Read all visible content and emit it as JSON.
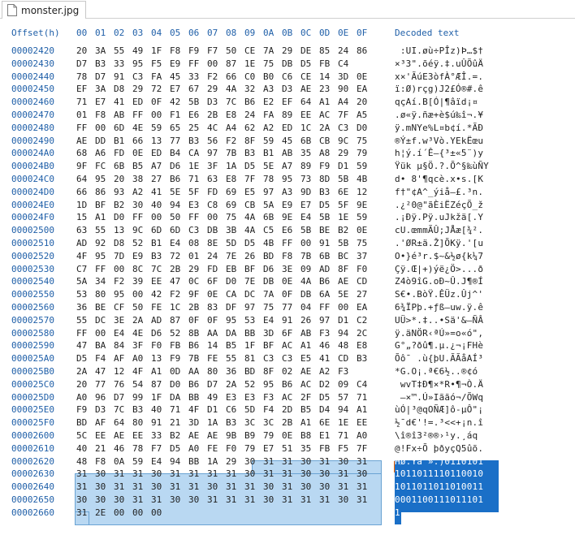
{
  "tab": {
    "title": "monster.jpg"
  },
  "header": {
    "offset_label": "Offset(h)",
    "columns": [
      "00",
      "01",
      "02",
      "03",
      "04",
      "05",
      "06",
      "07",
      "08",
      "09",
      "0A",
      "0B",
      "0C",
      "0D",
      "0E",
      "0F"
    ],
    "decoded_label": "Decoded text"
  },
  "rows": [
    {
      "offset": "00002420",
      "hex": [
        "20",
        "3A",
        "55",
        "49",
        "1F",
        "F8",
        "F9",
        "F7",
        "50",
        "CE",
        "7A",
        "29",
        "DE",
        "85",
        "24",
        "86"
      ],
      "text": " :UI.øù÷PÎz)Þ…$†"
    },
    {
      "offset": "00002430",
      "hex": [
        "D7",
        "B3",
        "33",
        "95",
        "F5",
        "E9",
        "FF",
        "00",
        "87",
        "1E",
        "75",
        "DB",
        "D5",
        "FB",
        "C4"
      ],
      "text": "×³3\".õéÿ.‡.uÛÕûÄ"
    },
    {
      "offset": "00002440",
      "hex": [
        "78",
        "D7",
        "91",
        "C3",
        "FA",
        "45",
        "33",
        "F2",
        "66",
        "C0",
        "B0",
        "C6",
        "CE",
        "14",
        "3D",
        "0E"
      ],
      "text": "x×'ÃúE3òfÀ°ÆÎ.=."
    },
    {
      "offset": "00002450",
      "hex": [
        "EF",
        "3A",
        "D8",
        "29",
        "72",
        "E7",
        "67",
        "29",
        "4A",
        "32",
        "A3",
        "D3",
        "AE",
        "23",
        "90",
        "EA"
      ],
      "text": "ï:Ø)rçg)J2£Ó®#.ê"
    },
    {
      "offset": "00002460",
      "hex": [
        "71",
        "E7",
        "41",
        "ED",
        "0F",
        "42",
        "5B",
        "D3",
        "7C",
        "B6",
        "E2",
        "EF",
        "64",
        "A1",
        "A4",
        "20"
      ],
      "text": "qçAí.B[Ó|¶âïd¡¤ "
    },
    {
      "offset": "00002470",
      "hex": [
        "01",
        "F8",
        "AB",
        "FF",
        "00",
        "F1",
        "E6",
        "2B",
        "E8",
        "24",
        "FA",
        "89",
        "EE",
        "AC",
        "7F",
        "A5"
      ],
      "text": ".ø«ÿ.ñæ+è$ú‰î¬.¥"
    },
    {
      "offset": "00002480",
      "hex": [
        "FF",
        "00",
        "6D",
        "4E",
        "59",
        "65",
        "25",
        "4C",
        "A4",
        "62",
        "A2",
        "ED",
        "1C",
        "2A",
        "C3",
        "D0"
      ],
      "text": "ÿ.mNYe%L¤b¢í.*ÃÐ"
    },
    {
      "offset": "00002490",
      "hex": [
        "AE",
        "DD",
        "B1",
        "66",
        "13",
        "77",
        "B3",
        "56",
        "F2",
        "8F",
        "59",
        "45",
        "6B",
        "CB",
        "9C",
        "75"
      ],
      "text": "®Ý±f.w³Vò.YEkËœu"
    },
    {
      "offset": "000024A0",
      "hex": [
        "68",
        "A6",
        "FD",
        "0E",
        "ED",
        "B4",
        "CA",
        "97",
        "7B",
        "B3",
        "B1",
        "AB",
        "35",
        "A8",
        "29",
        "79"
      ],
      "text": "h¦ý.í´Ê—{³±«5¨)y"
    },
    {
      "offset": "000024B0",
      "hex": [
        "9F",
        "FC",
        "6B",
        "B5",
        "A7",
        "D6",
        "1E",
        "3F",
        "1A",
        "D5",
        "5E",
        "A7",
        "89",
        "F9",
        "D1",
        "59"
      ],
      "text": "Ÿük µ§Ö.?.Õ^§‰ùÑY"
    },
    {
      "offset": "000024C0",
      "hex": [
        "64",
        "95",
        "20",
        "38",
        "27",
        "B6",
        "71",
        "63",
        "E8",
        "7F",
        "78",
        "95",
        "73",
        "8D",
        "5B",
        "4B"
      ],
      "text": "d• 8'¶qcè.x•s.[K"
    },
    {
      "offset": "000024D0",
      "hex": [
        "66",
        "86",
        "93",
        "A2",
        "41",
        "5E",
        "5F",
        "FD",
        "69",
        "E5",
        "97",
        "A3",
        "9D",
        "B3",
        "6E",
        "12"
      ],
      "text": "f†\"¢A^_ýiå—£.³n."
    },
    {
      "offset": "000024E0",
      "hex": [
        "1D",
        "BF",
        "B2",
        "30",
        "40",
        "94",
        "E3",
        "C8",
        "69",
        "CB",
        "5A",
        "E9",
        "E7",
        "D5",
        "5F",
        "9E"
      ],
      "text": ".¿²0@\"ãÈiËZéçÕ_ž"
    },
    {
      "offset": "000024F0",
      "hex": [
        "15",
        "A1",
        "D0",
        "FF",
        "00",
        "50",
        "FF",
        "00",
        "75",
        "4A",
        "6B",
        "9E",
        "E4",
        "5B",
        "1E",
        "59"
      ],
      "text": ".¡Ðÿ.Pÿ.uJkžä[.Y"
    },
    {
      "offset": "00002500",
      "hex": [
        "63",
        "55",
        "13",
        "9C",
        "6D",
        "6D",
        "C3",
        "DB",
        "3B",
        "4A",
        "C5",
        "E6",
        "5B",
        "BE",
        "B2",
        "0E"
      ],
      "text": "cU.œmmÃÛ;JÅæ[¾²."
    },
    {
      "offset": "00002510",
      "hex": [
        "AD",
        "92",
        "D8",
        "52",
        "B1",
        "E4",
        "08",
        "8E",
        "5D",
        "D5",
        "4B",
        "FF",
        "00",
        "91",
        "5B",
        "75"
      ],
      "text": ".'ØR±ä.Ž]ÕKÿ.'[u"
    },
    {
      "offset": "00002520",
      "hex": [
        "4F",
        "95",
        "7D",
        "E9",
        "B3",
        "72",
        "01",
        "24",
        "7E",
        "26",
        "BD",
        "F8",
        "7B",
        "6B",
        "BC",
        "37"
      ],
      "text": "O•}é³r.$~&½ø{k¼7"
    },
    {
      "offset": "00002530",
      "hex": [
        "C7",
        "FF",
        "00",
        "8C",
        "7C",
        "2B",
        "29",
        "FD",
        "EB",
        "BF",
        "D6",
        "3E",
        "09",
        "AD",
        "8F",
        "F0"
      ],
      "text": "Çÿ.Œ|+)ýë¿Ö>...ð"
    },
    {
      "offset": "00002540",
      "hex": [
        "5A",
        "34",
        "F2",
        "39",
        "EE",
        "47",
        "0C",
        "6F",
        "D0",
        "7E",
        "DB",
        "0E",
        "4A",
        "B6",
        "AE",
        "CD"
      ],
      "text": "Z4ò9îG.oÐ~Û.J¶®Í"
    },
    {
      "offset": "00002550",
      "hex": [
        "53",
        "80",
        "95",
        "00",
        "42",
        "F2",
        "9F",
        "0E",
        "CA",
        "DC",
        "7A",
        "0F",
        "DB",
        "6A",
        "5E",
        "27"
      ],
      "text": "S€•.BòŸ.ÊÜz.Ûj^'"
    },
    {
      "offset": "00002560",
      "hex": [
        "36",
        "BE",
        "CF",
        "50",
        "FE",
        "1C",
        "2B",
        "83",
        "DF",
        "97",
        "75",
        "77",
        "04",
        "FF",
        "00",
        "EA"
      ],
      "text": "6¾ÏPþ.+ƒß—uw.ÿ.ê"
    },
    {
      "offset": "00002570",
      "hex": [
        "55",
        "DC",
        "3E",
        "2A",
        "AD",
        "87",
        "0F",
        "0F",
        "95",
        "53",
        "E4",
        "91",
        "26",
        "97",
        "D1",
        "C2"
      ],
      "text": "UÜ>*.‡..•Sä'&—ÑÂ"
    },
    {
      "offset": "00002580",
      "hex": [
        "FF",
        "00",
        "E4",
        "4E",
        "D6",
        "52",
        "8B",
        "AA",
        "DA",
        "BB",
        "3D",
        "6F",
        "AB",
        "F3",
        "94",
        "2C"
      ],
      "text": "ÿ.äNÖR‹ªÚ»=o«ó\","
    },
    {
      "offset": "00002590",
      "hex": [
        "47",
        "BA",
        "84",
        "3F",
        "F0",
        "FB",
        "B6",
        "14",
        "B5",
        "1F",
        "BF",
        "AC",
        "A1",
        "46",
        "48",
        "E8"
      ],
      "text": "G°„?ðû¶.µ.¿¬¡FHè"
    },
    {
      "offset": "000025A0",
      "hex": [
        "D5",
        "F4",
        "AF",
        "A0",
        "13",
        "F9",
        "7B",
        "FE",
        "55",
        "81",
        "C3",
        "C3",
        "E5",
        "41",
        "CD",
        "B3"
      ],
      "text": "Õô¯ .ù{þU.ÃÃåAÍ³"
    },
    {
      "offset": "000025B0",
      "hex": [
        "2A",
        "47",
        "12",
        "4F",
        "A1",
        "0D",
        "AA",
        "80",
        "36",
        "BD",
        "8F",
        "02",
        "AE",
        "A2",
        "F3"
      ],
      "text": "*G.O¡.ª€6½..®¢ó"
    },
    {
      "offset": "000025C0",
      "hex": [
        "20",
        "77",
        "76",
        "54",
        "87",
        "D0",
        "B6",
        "D7",
        "2A",
        "52",
        "95",
        "B6",
        "AC",
        "D2",
        "09",
        "C4"
      ],
      "text": " wvT‡Ð¶×*R•¶¬Ò.Ä"
    },
    {
      "offset": "000025D0",
      "hex": [
        "A0",
        "96",
        "D7",
        "99",
        "1F",
        "DA",
        "BB",
        "49",
        "E3",
        "E3",
        "F3",
        "AC",
        "2F",
        "D5",
        "57",
        "71"
      ],
      "text": " –×™.Ú»Iããó¬/ÕWq"
    },
    {
      "offset": "000025E0",
      "hex": [
        "F9",
        "D3",
        "7C",
        "B3",
        "40",
        "71",
        "4F",
        "D1",
        "C6",
        "5D",
        "F4",
        "2D",
        "B5",
        "D4",
        "94",
        "A1"
      ],
      "text": "ùÓ|³@qOÑÆ]ô-µÔ\"¡"
    },
    {
      "offset": "000025F0",
      "hex": [
        "BD",
        "AF",
        "64",
        "80",
        "91",
        "21",
        "3D",
        "1A",
        "B3",
        "3C",
        "3C",
        "2B",
        "A1",
        "6E",
        "1E",
        "EE"
      ],
      "text": "½¯d€'!=.³<<+¡n.î"
    },
    {
      "offset": "00002600",
      "hex": [
        "5C",
        "EE",
        "AE",
        "EE",
        "33",
        "B2",
        "AE",
        "AE",
        "9B",
        "B9",
        "79",
        "0E",
        "B8",
        "E1",
        "71",
        "A0"
      ],
      "text": "\\î®î3²®®›¹y.¸áq "
    },
    {
      "offset": "00002610",
      "hex": [
        "40",
        "21",
        "46",
        "78",
        "F7",
        "D5",
        "A0",
        "FE",
        "F0",
        "79",
        "E7",
        "51",
        "35",
        "FB",
        "F5",
        "7F"
      ],
      "text": "@!Fx÷Õ þðyçQ5ûõ."
    },
    {
      "offset": "00002620",
      "hex": [
        "48",
        "F8",
        "0A",
        "59",
        "E4",
        "94",
        "BB",
        "1A",
        "29",
        "30",
        "31",
        "31",
        "30",
        "31",
        "30",
        "31"
      ],
      "text": "Hø.Yä\"».)0110101"
    },
    {
      "offset": "00002630",
      "hex": [
        "31",
        "30",
        "31",
        "31",
        "30",
        "31",
        "31",
        "31",
        "31",
        "30",
        "31",
        "31",
        "30",
        "30",
        "31",
        "30"
      ],
      "text": "1011011110110010"
    },
    {
      "offset": "00002640",
      "hex": [
        "31",
        "30",
        "31",
        "31",
        "30",
        "31",
        "31",
        "30",
        "31",
        "31",
        "30",
        "31",
        "30",
        "30",
        "31",
        "31"
      ],
      "text": "1011011011010011"
    },
    {
      "offset": "00002650",
      "hex": [
        "30",
        "30",
        "30",
        "31",
        "31",
        "30",
        "30",
        "31",
        "31",
        "31",
        "30",
        "31",
        "31",
        "31",
        "30",
        "31"
      ],
      "text": "0001100111011101"
    },
    {
      "offset": "00002660",
      "hex": [
        "31",
        "2E",
        "00",
        "00",
        "00"
      ],
      "text": "1...."
    }
  ],
  "selection": {
    "start_offset": "00002629",
    "end_offset": "00002660"
  }
}
